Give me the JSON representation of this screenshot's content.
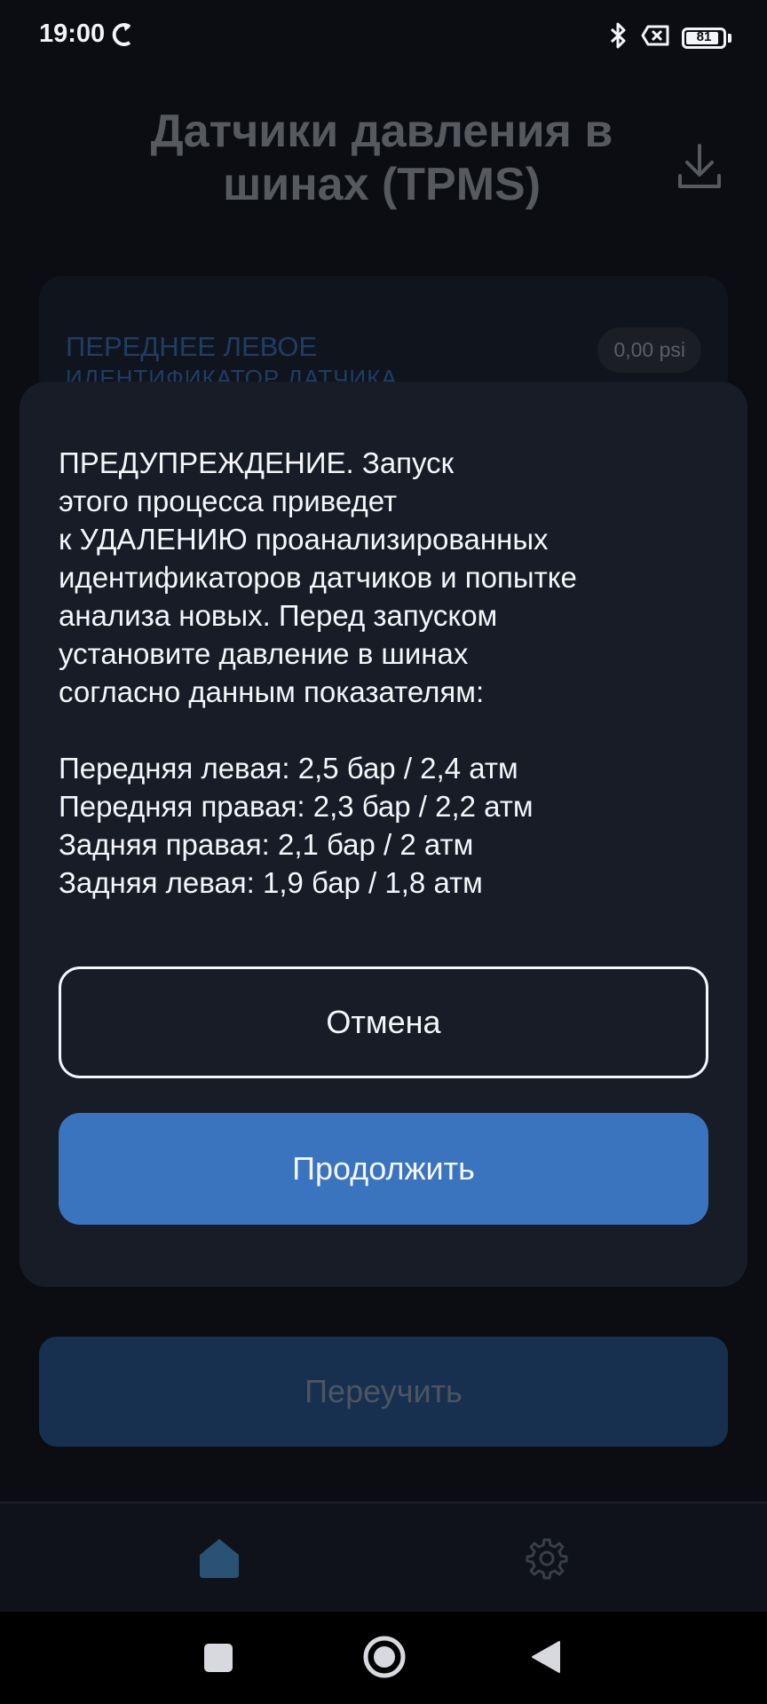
{
  "status_bar": {
    "time": "19:00",
    "battery_level": "81",
    "icons": [
      "sync-icon",
      "bluetooth-icon",
      "no-sim-icon",
      "battery-icon"
    ]
  },
  "header": {
    "title": "Датчики давления в шинах (TPMS)",
    "download_icon": "download-icon"
  },
  "sensor_card": {
    "title": "ПЕРЕДНЕЕ ЛЕВОЕ",
    "subtitle": "ИДЕНТИФИКАТОР ДАТЧИКА",
    "pressure": "0,00 psi"
  },
  "dialog": {
    "warning_text": "ПРЕДУПРЕЖДЕНИЕ. Запуск\nэтого процесса приведет\nк УДАЛЕНИЮ проанализированных\nидентификаторов датчиков и попытке\nанализа новых. Перед запуском\nустановите давление в шинах\nсогласно данным показателям:\n\nПередняя левая: 2,5 бар / 2,4 атм\nПередняя правая: 2,3 бар / 2,2 атм\nЗадняя правая: 2,1 бар / 2 атм\nЗадняя левая: 1,9 бар / 1,8 атм",
    "cancel_label": "Отмена",
    "continue_label": "Продолжить"
  },
  "relearn_button": {
    "label": "Переучить"
  },
  "bottom_nav": {
    "items": [
      "home-icon",
      "gear-icon"
    ]
  },
  "colors": {
    "background": "#0b0d12",
    "dialog": "#171c26",
    "accent": "#3a74bf",
    "text": "#f4f6f9"
  }
}
